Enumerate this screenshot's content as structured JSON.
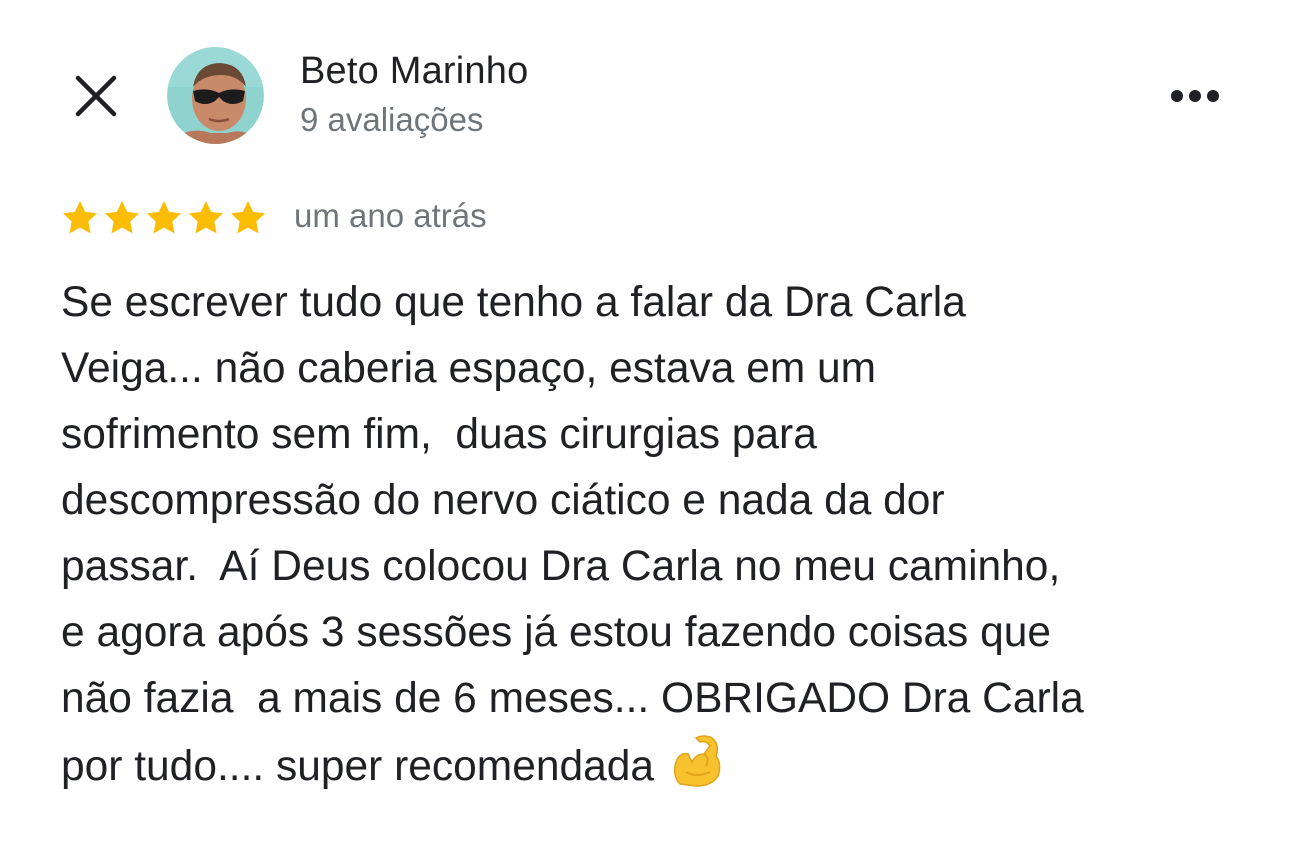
{
  "header": {
    "close_icon": "close-icon",
    "user_name": "Beto Marinho",
    "review_count": "9 avaliações",
    "more_icon": "more-horizontal-icon"
  },
  "rating": {
    "stars": 5,
    "max_stars": 5,
    "star_color": "#FBBC04",
    "time_ago": "um ano atrás"
  },
  "review": {
    "lines": [
      "Se escrever tudo que tenho a falar da Dra Carla",
      "Veiga... não caberia espaço, estava em um",
      "sofrimento sem fim,  duas cirurgias para",
      "descompressão do nervo ciático e nada da dor",
      "passar.  Aí Deus colocou Dra Carla no meu caminho,",
      "e agora após 3 sessões já estou fazendo coisas que",
      "não fazia  a mais de 6 meses... OBRIGADO Dra Carla",
      "por tudo.... super recomendada"
    ],
    "trailing_emoji": "flexed-biceps-emoji"
  },
  "colors": {
    "text_primary": "#202124",
    "text_secondary": "#70757a",
    "background": "#ffffff"
  }
}
